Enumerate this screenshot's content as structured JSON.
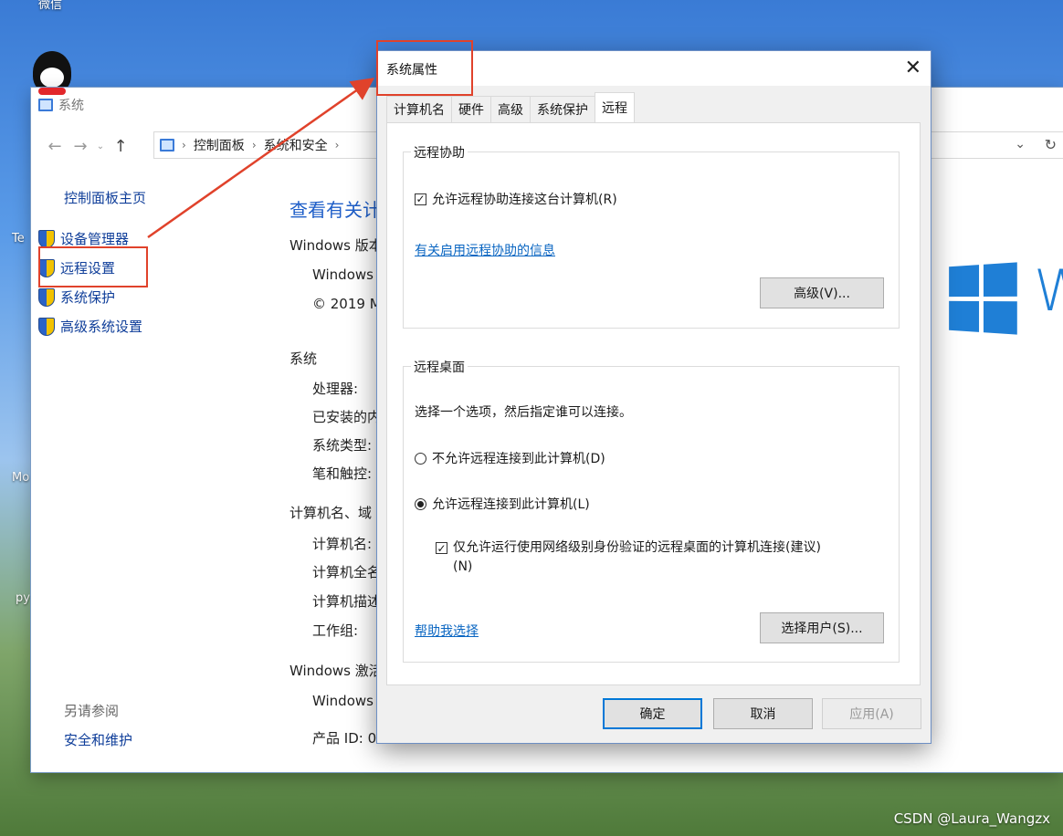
{
  "desktop": {
    "top_label": "微信",
    "side_labels": [
      "Te",
      "Mo",
      "py"
    ]
  },
  "system_window": {
    "title": "系统",
    "breadcrumb": [
      "控制面板",
      "系统和安全"
    ],
    "left_nav": {
      "home": "控制面板主页",
      "items": [
        "设备管理器",
        "远程设置",
        "系统保护",
        "高级系统设置"
      ],
      "see_also_header": "另请参阅",
      "see_also_items": [
        "安全和维护"
      ]
    },
    "content": {
      "title": "查看有关计",
      "edition_header": "Windows 版本",
      "edition_lines": [
        "Windows",
        "© 2019 M"
      ],
      "system_header": "系统",
      "system_labels": [
        "处理器:",
        "已安装的内",
        "系统类型:",
        "笔和触控:"
      ],
      "computer_header": "计算机名、域",
      "computer_labels": [
        "计算机名:",
        "计算机全名",
        "计算机描述",
        "工作组:"
      ],
      "activation_header": "Windows 激活",
      "activation_lines": [
        "Windows",
        "产品 ID: 0"
      ]
    },
    "logo_letter": "W"
  },
  "dialog": {
    "title": "系统属性",
    "close_glyph": "✕",
    "tabs": [
      "计算机名",
      "硬件",
      "高级",
      "系统保护",
      "远程"
    ],
    "active_tab": "远程",
    "remote_assistance": {
      "group_title": "远程协助",
      "checkbox_label": "允许远程协助连接这台计算机(R)",
      "checked": true,
      "info_link": "有关启用远程协助的信息",
      "advanced_button": "高级(V)..."
    },
    "remote_desktop": {
      "group_title": "远程桌面",
      "instruction": "选择一个选项，然后指定谁可以连接。",
      "option_deny": "不允许远程连接到此计算机(D)",
      "option_allow": "允许远程连接到此计算机(L)",
      "selected": "allow",
      "nla_label_line1": "仅允许运行使用网络级别身份验证的远程桌面的计算机连接(建议)",
      "nla_label_line2": "(N)",
      "nla_checked": true,
      "help_link": "帮助我选择",
      "select_users_button": "选择用户(S)..."
    },
    "buttons": {
      "ok": "确定",
      "cancel": "取消",
      "apply": "应用(A)"
    }
  },
  "watermark": "CSDN @Laura_Wangzx",
  "colors": {
    "annotation_red": "#e0422b",
    "link_blue": "#0a66c2",
    "accent": "#0078d7"
  }
}
